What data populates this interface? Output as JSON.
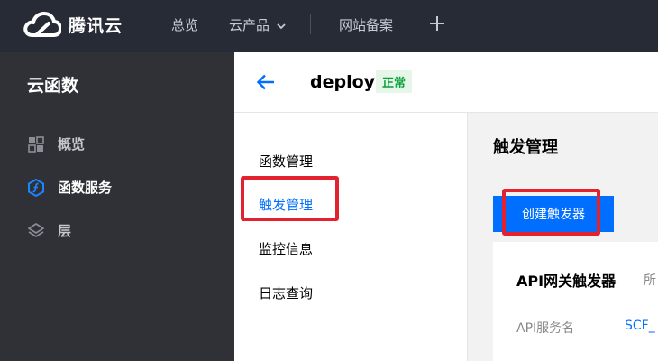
{
  "topbar": {
    "brand": "腾讯云",
    "nav": {
      "overview": "总览",
      "products": "云产品",
      "filing": "网站备案"
    }
  },
  "sidebar": {
    "title": "云函数",
    "items": [
      {
        "label": "概览",
        "icon": "grid-icon"
      },
      {
        "label": "函数服务",
        "icon": "function-icon",
        "active": true
      },
      {
        "label": "层",
        "icon": "layers-icon"
      }
    ]
  },
  "header": {
    "function_name": "deploy",
    "status": "正常"
  },
  "submenu": {
    "items": [
      "函数管理",
      "触发管理",
      "监控信息",
      "日志查询"
    ],
    "active": "触发管理"
  },
  "main": {
    "title": "触发管理",
    "create_button": "创建触发器",
    "card": {
      "title": "API网关触发器",
      "extra": "所",
      "label": "API服务名",
      "value": "SCF_"
    }
  },
  "colors": {
    "topbar_bg": "#262b36",
    "sidebar_bg": "#2f3136",
    "accent": "#006eff",
    "status_green": "#0aa33a",
    "highlight_red": "#e3222f"
  }
}
